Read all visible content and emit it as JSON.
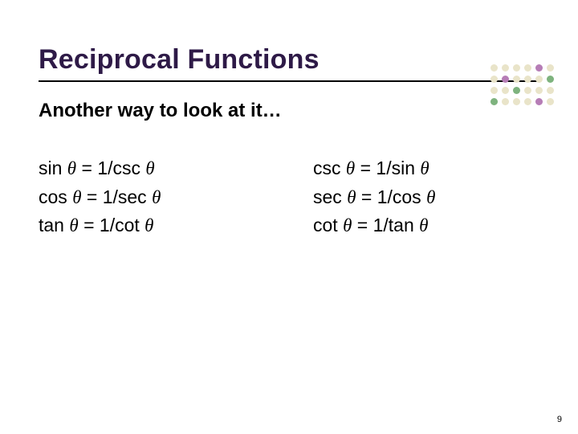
{
  "title": "Reciprocal Functions",
  "subtitle": "Another way to look at it…",
  "left": {
    "e1a": "sin ",
    "e1b": " = 1/csc ",
    "e2a": "cos ",
    "e2b": " = 1/sec ",
    "e3a": "tan ",
    "e3b": " = 1/cot "
  },
  "right": {
    "e1a": "csc ",
    "e1b": " = 1/sin ",
    "e2a": "sec ",
    "e2b": " = 1/cos ",
    "e3a": "cot ",
    "e3b": " = 1/tan "
  },
  "theta": "θ",
  "pagenum": "9",
  "dot_colors": {
    "r1": [
      "#e9e4c9",
      "#e9e4c9",
      "#e9e4c9",
      "#e9e4c9",
      "#b67db6",
      "#e9e4c9"
    ],
    "r2": [
      "#e9e4c9",
      "#b67db6",
      "#e9e4c9",
      "#e9e4c9",
      "#e9e4c9",
      "#7eb37e"
    ],
    "r3": [
      "#e9e4c9",
      "#e9e4c9",
      "#7eb37e",
      "#e9e4c9",
      "#e9e4c9",
      "#e9e4c9"
    ],
    "r4": [
      "#7eb37e",
      "#e9e4c9",
      "#e9e4c9",
      "#e9e4c9",
      "#b67db6",
      "#e9e4c9"
    ]
  }
}
